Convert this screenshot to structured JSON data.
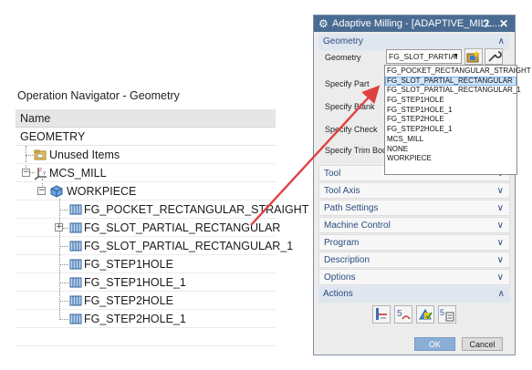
{
  "navigator": {
    "title": "Operation Navigator - Geometry",
    "column_header": "Name",
    "root_label": "GEOMETRY",
    "items": [
      {
        "label": "Unused Items",
        "icon": "folder-icon"
      },
      {
        "label": "MCS_MILL",
        "icon": "coordinate-system-icon"
      },
      {
        "label": "WORKPIECE",
        "icon": "workpiece-icon"
      },
      {
        "label": "FG_POCKET_RECTANGULAR_STRAIGHT",
        "icon": "feature-group-icon"
      },
      {
        "label": "FG_SLOT_PARTIAL_RECTANGULAR",
        "icon": "feature-group-icon"
      },
      {
        "label": "FG_SLOT_PARTIAL_RECTANGULAR_1",
        "icon": "feature-group-icon"
      },
      {
        "label": "FG_STEP1HOLE",
        "icon": "feature-group-icon"
      },
      {
        "label": "FG_STEP1HOLE_1",
        "icon": "feature-group-icon"
      },
      {
        "label": "FG_STEP2HOLE",
        "icon": "feature-group-icon"
      },
      {
        "label": "FG_STEP2HOLE_1",
        "icon": "feature-group-icon"
      }
    ],
    "expander_plus": "+",
    "expander_minus": "−"
  },
  "dialog": {
    "title": "Adaptive Milling - [ADAPTIVE_MILL...",
    "help": "?",
    "close": "✕",
    "geometry_section": "Geometry",
    "geometry_label": "Geometry",
    "geometry_value": "FG_SLOT_PARTIAI",
    "specify_part": "Specify Part",
    "specify_blank": "Specify Blank",
    "specify_check": "Specify Check",
    "specify_trim": "Specify Trim Boun",
    "sections": [
      "Tool",
      "Tool Axis",
      "Path Settings",
      "Machine Control",
      "Program",
      "Description",
      "Options"
    ],
    "actions_section": "Actions",
    "ok": "OK",
    "cancel": "Cancel"
  },
  "dropdown": {
    "options": [
      "FG_POCKET_RECTANGULAR_STRAIGHT",
      "FG_SLOT_PARTIAL_RECTANGULAR",
      "FG_SLOT_PARTIAL_RECTANGULAR_1",
      "FG_STEP1HOLE",
      "FG_STEP1HOLE_1",
      "FG_STEP2HOLE",
      "FG_STEP2HOLE_1",
      "MCS_MILL",
      "NONE",
      "WORKPIECE"
    ],
    "selected": "FG_SLOT_PARTIAL_RECTANGULAR"
  },
  "colors": {
    "title_bar": "#4a6c93",
    "section_text": "#2a4d80",
    "arrow": "#e04040",
    "selection": "#cfe5fb"
  }
}
